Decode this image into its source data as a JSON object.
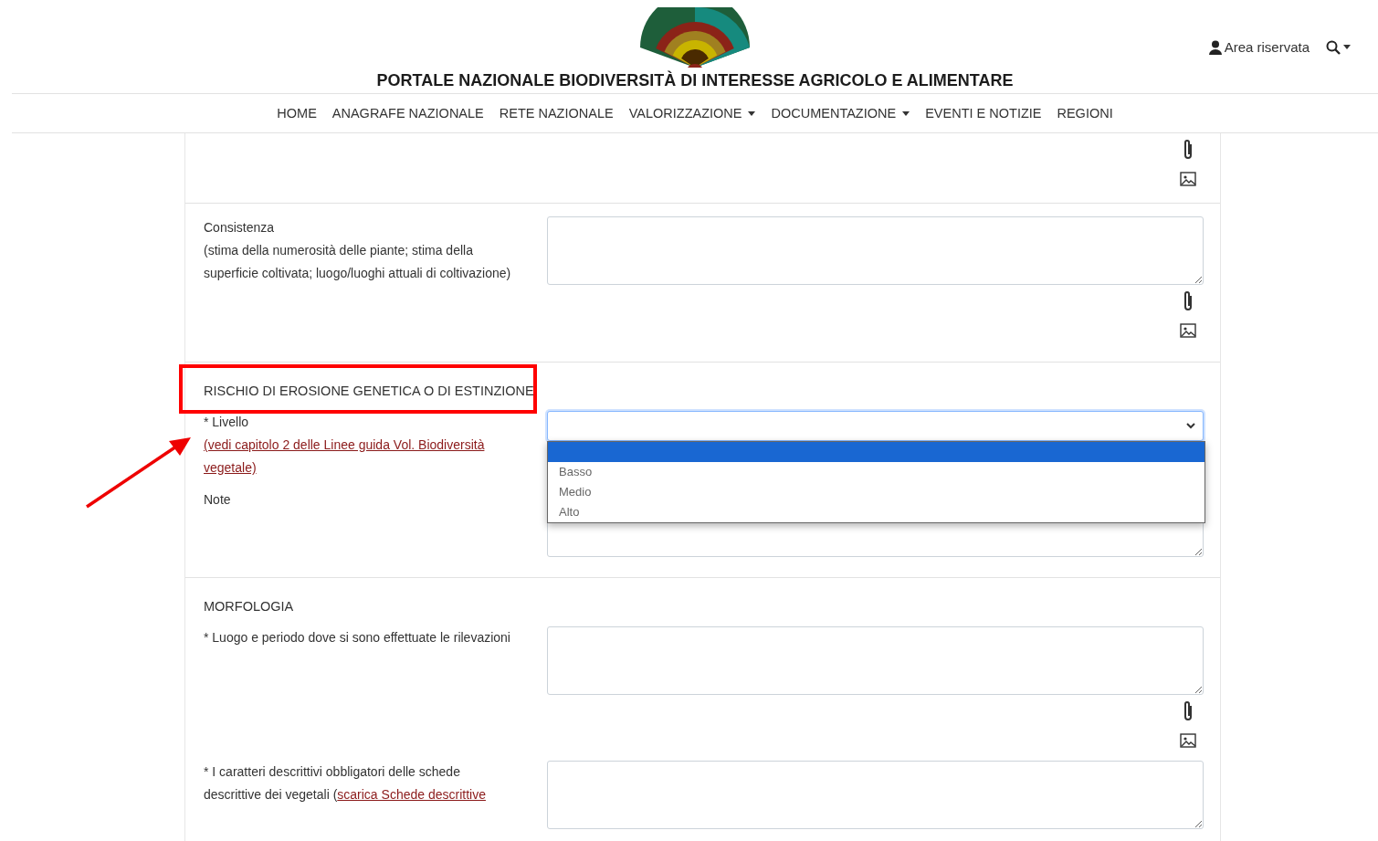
{
  "header": {
    "title": "PORTALE NAZIONALE BIODIVERSITÀ DI INTERESSE AGRICOLO E ALIMENTARE",
    "account_link": "Area riservata"
  },
  "nav": [
    {
      "label": "HOME",
      "dropdown": false
    },
    {
      "label": "ANAGRAFE NAZIONALE",
      "dropdown": false
    },
    {
      "label": "RETE NAZIONALE",
      "dropdown": false
    },
    {
      "label": "VALORIZZAZIONE",
      "dropdown": true
    },
    {
      "label": "DOCUMENTAZIONE",
      "dropdown": true
    },
    {
      "label": "EVENTI E NOTIZIE",
      "dropdown": false
    },
    {
      "label": "REGIONI",
      "dropdown": false
    }
  ],
  "sections": [
    {
      "fields": [
        {
          "kind": "attachments",
          "attachments": true
        }
      ]
    },
    {
      "fields": [
        {
          "kind": "textarea",
          "label": "Consistenza",
          "note": "(stima della numerosità delle piante; stima della superficie coltivata; luogo/luoghi attuali di coltivazione)",
          "attachments": true
        }
      ]
    },
    {
      "heading": "RISCHIO DI EROSIONE GENETICA O DI ESTINZIONE",
      "highlighted": true,
      "fields": [
        {
          "kind": "select",
          "label": "* Livello",
          "link": "(vedi capitolo 2 delle Linee guida Vol. Biodiversità vegetale)",
          "focused": true,
          "expanded": true,
          "options": [
            {
              "selected": true
            },
            {
              "label": "Basso",
              "selected": false
            },
            {
              "label": "Medio",
              "selected": false
            },
            {
              "label": "Alto",
              "selected": false
            }
          ]
        },
        {
          "kind": "textarea",
          "label": "Note",
          "attachments": false
        }
      ]
    },
    {
      "heading": "MORFOLOGIA",
      "highlighted": false,
      "fields": [
        {
          "kind": "textarea",
          "label": "* Luogo e periodo dove si sono effettuate le rilevazioni",
          "attachments": true
        },
        {
          "kind": "textarea",
          "label": "* I caratteri descrittivi obbligatori delle schede descrittive dei vegetali",
          "link_open": "(",
          "link": "scarica Schede descrittive",
          "attachments": false
        }
      ]
    }
  ]
}
